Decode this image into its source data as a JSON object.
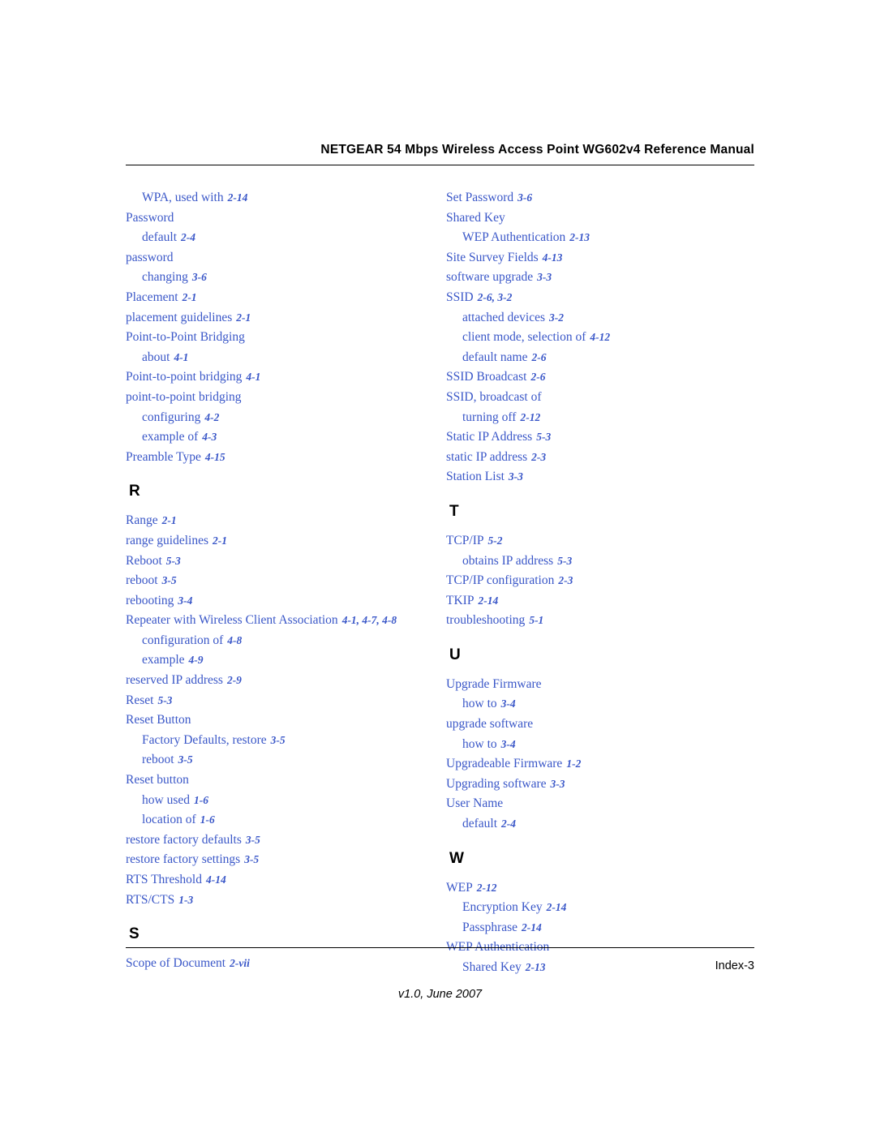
{
  "header": {
    "title": "NETGEAR 54 Mbps Wireless Access Point WG602v4 Reference Manual"
  },
  "footer": {
    "page_label": "Index-3",
    "version": "v1.0, June 2007"
  },
  "index": {
    "left_column": [
      {
        "type": "entry",
        "level": 2,
        "text": "WPA, used with",
        "page": "2-14"
      },
      {
        "type": "entry",
        "level": 1,
        "text": "Password",
        "page": ""
      },
      {
        "type": "entry",
        "level": 2,
        "text": "default",
        "page": "2-4"
      },
      {
        "type": "entry",
        "level": 1,
        "text": "password",
        "page": ""
      },
      {
        "type": "entry",
        "level": 2,
        "text": "changing",
        "page": "3-6"
      },
      {
        "type": "entry",
        "level": 1,
        "text": "Placement",
        "page": "2-1"
      },
      {
        "type": "entry",
        "level": 1,
        "text": "placement guidelines",
        "page": "2-1"
      },
      {
        "type": "entry",
        "level": 1,
        "text": "Point-to-Point Bridging",
        "page": ""
      },
      {
        "type": "entry",
        "level": 2,
        "text": "about",
        "page": "4-1"
      },
      {
        "type": "entry",
        "level": 1,
        "text": "Point-to-point bridging",
        "page": "4-1"
      },
      {
        "type": "entry",
        "level": 1,
        "text": "point-to-point bridging",
        "page": ""
      },
      {
        "type": "entry",
        "level": 2,
        "text": "configuring",
        "page": "4-2"
      },
      {
        "type": "entry",
        "level": 2,
        "text": "example of",
        "page": "4-3"
      },
      {
        "type": "entry",
        "level": 1,
        "text": "Preamble Type",
        "page": "4-15"
      },
      {
        "type": "letter",
        "text": "R"
      },
      {
        "type": "entry",
        "level": 1,
        "text": "Range",
        "page": "2-1"
      },
      {
        "type": "entry",
        "level": 1,
        "text": "range guidelines",
        "page": "2-1"
      },
      {
        "type": "entry",
        "level": 1,
        "text": "Reboot",
        "page": "5-3"
      },
      {
        "type": "entry",
        "level": 1,
        "text": "reboot",
        "page": "3-5"
      },
      {
        "type": "entry",
        "level": 1,
        "text": "rebooting",
        "page": "3-4"
      },
      {
        "type": "entry",
        "level": 1,
        "text": "Repeater with Wireless Client Association",
        "page": "4-1, 4-7, 4-8"
      },
      {
        "type": "entry",
        "level": 2,
        "text": "configuration of",
        "page": "4-8"
      },
      {
        "type": "entry",
        "level": 2,
        "text": "example",
        "page": "4-9"
      },
      {
        "type": "entry",
        "level": 1,
        "text": "reserved IP address",
        "page": "2-9"
      },
      {
        "type": "entry",
        "level": 1,
        "text": "Reset",
        "page": "5-3"
      },
      {
        "type": "entry",
        "level": 1,
        "text": "Reset Button",
        "page": ""
      },
      {
        "type": "entry",
        "level": 2,
        "text": "Factory Defaults, restore",
        "page": "3-5"
      },
      {
        "type": "entry",
        "level": 2,
        "text": "reboot",
        "page": "3-5"
      },
      {
        "type": "entry",
        "level": 1,
        "text": "Reset button",
        "page": ""
      },
      {
        "type": "entry",
        "level": 2,
        "text": "how used",
        "page": "1-6"
      },
      {
        "type": "entry",
        "level": 2,
        "text": "location of",
        "page": "1-6"
      },
      {
        "type": "entry",
        "level": 1,
        "text": "restore factory defaults",
        "page": "3-5"
      },
      {
        "type": "entry",
        "level": 1,
        "text": "restore factory settings",
        "page": "3-5"
      },
      {
        "type": "entry",
        "level": 1,
        "text": "RTS Threshold",
        "page": "4-14"
      },
      {
        "type": "entry",
        "level": 1,
        "text": "RTS/CTS",
        "page": "1-3"
      },
      {
        "type": "letter",
        "text": "S"
      },
      {
        "type": "entry",
        "level": 1,
        "text": "Scope of Document",
        "page": "2-vii"
      }
    ],
    "right_column": [
      {
        "type": "entry",
        "level": 1,
        "text": "Set Password",
        "page": "3-6"
      },
      {
        "type": "entry",
        "level": 1,
        "text": "Shared Key",
        "page": ""
      },
      {
        "type": "entry",
        "level": 2,
        "text": "WEP Authentication",
        "page": "2-13"
      },
      {
        "type": "entry",
        "level": 1,
        "text": "Site Survey Fields",
        "page": "4-13"
      },
      {
        "type": "entry",
        "level": 1,
        "text": "software upgrade",
        "page": "3-3"
      },
      {
        "type": "entry",
        "level": 1,
        "text": "SSID",
        "page": "2-6, 3-2"
      },
      {
        "type": "entry",
        "level": 2,
        "text": "attached devices",
        "page": "3-2"
      },
      {
        "type": "entry",
        "level": 2,
        "text": "client mode, selection of",
        "page": "4-12"
      },
      {
        "type": "entry",
        "level": 2,
        "text": "default name",
        "page": "2-6"
      },
      {
        "type": "entry",
        "level": 1,
        "text": "SSID Broadcast",
        "page": "2-6"
      },
      {
        "type": "entry",
        "level": 1,
        "text": "SSID, broadcast of",
        "page": ""
      },
      {
        "type": "entry",
        "level": 2,
        "text": "turning off",
        "page": "2-12"
      },
      {
        "type": "entry",
        "level": 1,
        "text": "Static IP Address",
        "page": "5-3"
      },
      {
        "type": "entry",
        "level": 1,
        "text": "static IP address",
        "page": "2-3"
      },
      {
        "type": "entry",
        "level": 1,
        "text": "Station List",
        "page": "3-3"
      },
      {
        "type": "letter",
        "text": "T"
      },
      {
        "type": "entry",
        "level": 1,
        "text": "TCP/IP",
        "page": "5-2"
      },
      {
        "type": "entry",
        "level": 2,
        "text": "obtains IP address",
        "page": "5-3"
      },
      {
        "type": "entry",
        "level": 1,
        "text": "TCP/IP configuration",
        "page": "2-3"
      },
      {
        "type": "entry",
        "level": 1,
        "text": "TKIP",
        "page": "2-14"
      },
      {
        "type": "entry",
        "level": 1,
        "text": "troubleshooting",
        "page": "5-1"
      },
      {
        "type": "letter",
        "text": "U"
      },
      {
        "type": "entry",
        "level": 1,
        "text": "Upgrade Firmware",
        "page": ""
      },
      {
        "type": "entry",
        "level": 2,
        "text": "how to",
        "page": "3-4"
      },
      {
        "type": "entry",
        "level": 1,
        "text": "upgrade software",
        "page": ""
      },
      {
        "type": "entry",
        "level": 2,
        "text": "how to",
        "page": "3-4"
      },
      {
        "type": "entry",
        "level": 1,
        "text": "Upgradeable Firmware",
        "page": "1-2"
      },
      {
        "type": "entry",
        "level": 1,
        "text": "Upgrading software",
        "page": "3-3"
      },
      {
        "type": "entry",
        "level": 1,
        "text": "User Name",
        "page": ""
      },
      {
        "type": "entry",
        "level": 2,
        "text": "default",
        "page": "2-4"
      },
      {
        "type": "letter",
        "text": "W"
      },
      {
        "type": "entry",
        "level": 1,
        "text": "WEP",
        "page": "2-12"
      },
      {
        "type": "entry",
        "level": 2,
        "text": "Encryption Key",
        "page": "2-14"
      },
      {
        "type": "entry",
        "level": 2,
        "text": "Passphrase",
        "page": "2-14"
      },
      {
        "type": "entry",
        "level": 1,
        "text": "WEP Authentication",
        "page": ""
      },
      {
        "type": "entry",
        "level": 2,
        "text": "Shared Key",
        "page": "2-13"
      }
    ]
  },
  "colors": {
    "link": "#3a57c8",
    "text": "#000000"
  }
}
